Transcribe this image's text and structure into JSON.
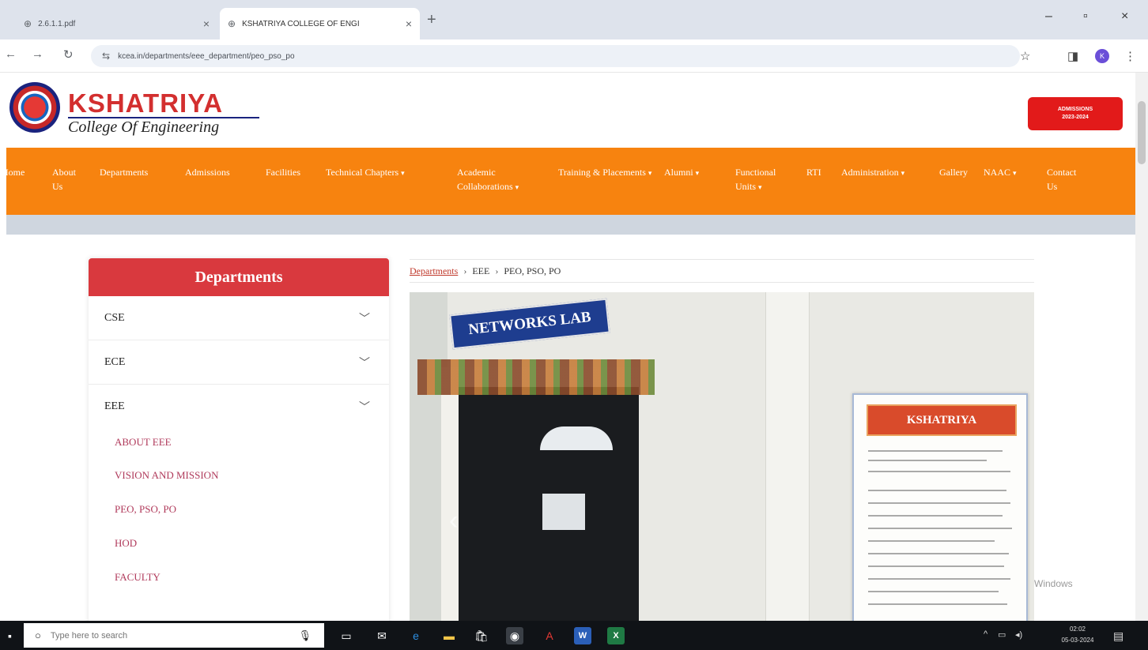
{
  "browser": {
    "tabs": [
      {
        "title": "2.6.1.1.pdf",
        "active": false
      },
      {
        "title": "KSHATRIYA COLLEGE OF ENGI",
        "active": true
      }
    ],
    "url": "kcea.in/departments/eee_department/peo_pso_po",
    "icons": {
      "back": "back-arrow-icon",
      "forward": "forward-arrow-icon",
      "reload": "reload-icon",
      "site_info": "tune-icon",
      "bookmark": "star-icon",
      "sidepanel": "side-panel-icon",
      "menu": "kebab-menu-icon"
    },
    "profile_initial": "K"
  },
  "site": {
    "logo_name": "KSHATRIYA",
    "logo_tagline": "College Of Engineering",
    "admissions_line1": "ADMISSIONS",
    "admissions_line2": "2023-2024",
    "nav": [
      {
        "label": "Home",
        "dropdown": false
      },
      {
        "label": "About Us",
        "dropdown": false
      },
      {
        "label": "Departments",
        "dropdown": false
      },
      {
        "label": "Admissions",
        "dropdown": false
      },
      {
        "label": "Facilities",
        "dropdown": false
      },
      {
        "label": "Technical Chapters",
        "dropdown": true
      },
      {
        "label": "Academic Collaborations",
        "dropdown": true
      },
      {
        "label": "Training & Placements",
        "dropdown": true
      },
      {
        "label": "Alumni",
        "dropdown": true
      },
      {
        "label": "Functional Units",
        "dropdown": true
      },
      {
        "label": "RTI",
        "dropdown": false
      },
      {
        "label": "Administration",
        "dropdown": true
      },
      {
        "label": "Gallery",
        "dropdown": false
      },
      {
        "label": "NAAC",
        "dropdown": true
      },
      {
        "label": "Contact Us",
        "dropdown": false
      }
    ],
    "sidebar": {
      "title": "Departments",
      "departments": [
        "CSE",
        "ECE",
        "EEE"
      ],
      "eee_items": [
        "ABOUT EEE",
        "VISION AND MISSION",
        "PEO, PSO, PO",
        "HOD",
        "FACULTY"
      ]
    },
    "breadcrumb": {
      "root": "Departments",
      "dept": "EEE",
      "current": "PEO, PSO, PO"
    },
    "photo": {
      "sign_text": "NETWORKS LAB",
      "notice_title": "KSHATRIYA"
    },
    "watermark": "Windows"
  },
  "taskbar": {
    "search_placeholder": "Type here to search",
    "time": "02:02",
    "date": "05-03-2024",
    "apps": [
      "task-view-icon",
      "mail-icon",
      "edge-icon",
      "file-explorer-icon",
      "store-icon",
      "chrome-icon",
      "acrobat-icon",
      "word-icon",
      "excel-icon"
    ]
  }
}
